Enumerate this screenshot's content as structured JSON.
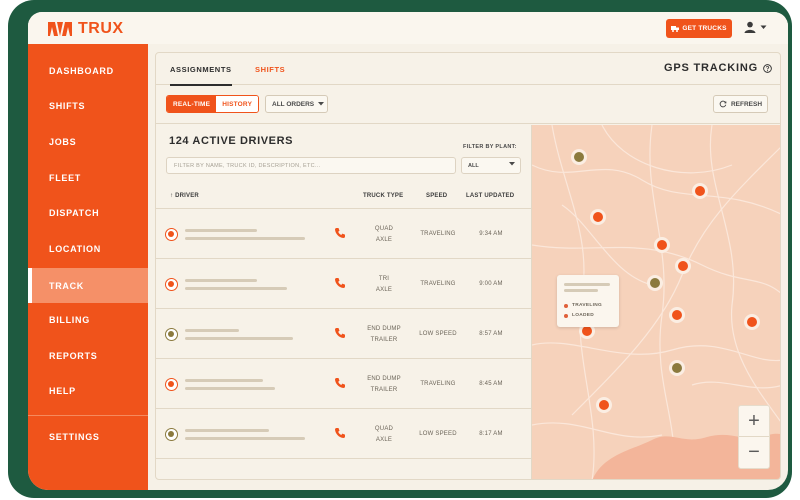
{
  "app": {
    "brand": "TRUX"
  },
  "header": {
    "get_trucks_label": "GET TRUCKS",
    "user_icon": "user-icon"
  },
  "sidebar": {
    "items": [
      {
        "label": "DASHBOARD"
      },
      {
        "label": "SHIFTS"
      },
      {
        "label": "JOBS"
      },
      {
        "label": "FLEET"
      },
      {
        "label": "DISPATCH"
      },
      {
        "label": "LOCATION"
      },
      {
        "label": "TRACK",
        "active": true
      },
      {
        "label": "BILLING"
      },
      {
        "label": "REPORTS"
      },
      {
        "label": "HELP"
      }
    ],
    "settings_label": "SETTINGS"
  },
  "tabs": [
    {
      "label": "ASSIGNMENTS",
      "active": true
    },
    {
      "label": "SHIFTS"
    }
  ],
  "gps": {
    "title": "GPS TRACKING"
  },
  "controls": {
    "realtime_label": "REAL-TIME",
    "history_label": "HISTORY",
    "orders_filter": "ALL ORDERS",
    "refresh_label": "REFRESH"
  },
  "drivers": {
    "title": "124 ACTIVE DRIVERS",
    "filter_label": "FILTER BY PLANT:",
    "filter_value": "ALL",
    "search_placeholder": "FILTER BY NAME, TRUCK ID, DESCRIPTION, ETC...",
    "columns": {
      "driver": "↑ DRIVER",
      "truck_type": "TRUCK TYPE",
      "speed": "SPEED",
      "last_updated": "LAST UPDATED"
    },
    "rows": [
      {
        "truck_line1": "QUAD",
        "truck_line2": "AXLE",
        "speed": "TRAVELING",
        "updated": "9:34 AM",
        "status": "loaded"
      },
      {
        "truck_line1": "TRI",
        "truck_line2": "AXLE",
        "speed": "TRAVELING",
        "updated": "9:00 AM",
        "status": "loaded"
      },
      {
        "truck_line1": "END DUMP",
        "truck_line2": "TRAILER",
        "speed": "LOW SPEED",
        "updated": "8:57 AM",
        "status": "traveling"
      },
      {
        "truck_line1": "END DUMP",
        "truck_line2": "TRAILER",
        "speed": "TRAVELING",
        "updated": "8:45 AM",
        "status": "loaded"
      },
      {
        "truck_line1": "QUAD",
        "truck_line2": "AXLE",
        "speed": "LOW SPEED",
        "updated": "8:17 AM",
        "status": "traveling"
      }
    ]
  },
  "map": {
    "legend": {
      "traveling": "TRAVELING",
      "loaded": "LOADED"
    },
    "zoom_in": "+",
    "zoom_out": "−"
  },
  "colors": {
    "accent": "#f0531b",
    "olive": "#8b7a3e",
    "frame": "#1e5a40",
    "map_bg": "#f6d2bb"
  }
}
